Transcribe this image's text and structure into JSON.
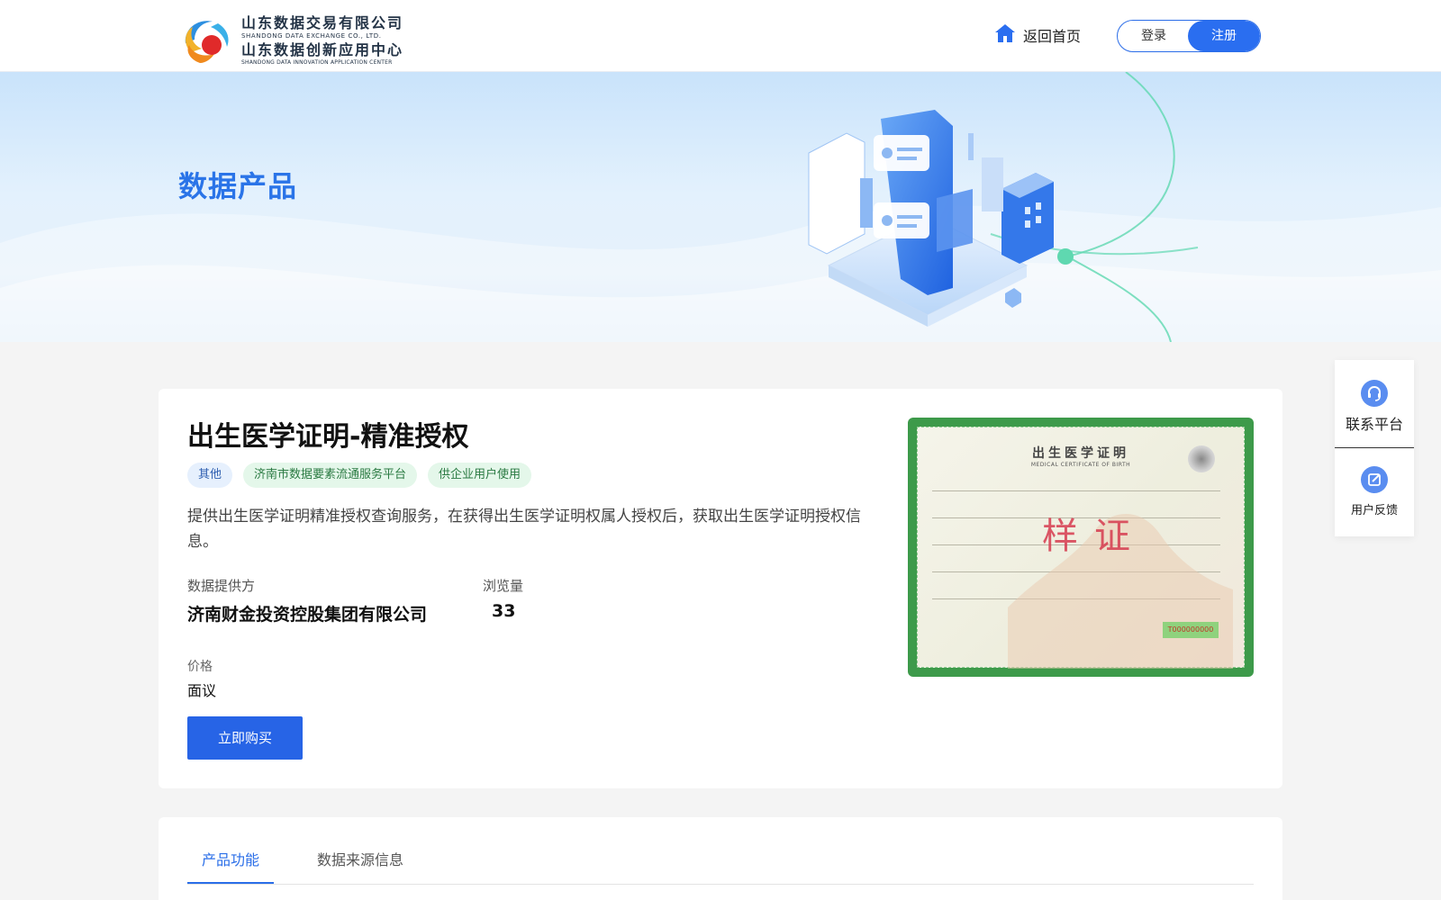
{
  "header": {
    "logo_cn_1": "山东数据交易有限公司",
    "logo_en_1": "SHANDONG DATA EXCHANGE CO., LTD.",
    "logo_cn_2": "山东数据创新应用中心",
    "logo_en_2": "SHANDONG DATA INNOVATION APPLICATION CENTER",
    "home_label": "返回首页",
    "login_label": "登录",
    "register_label": "注册"
  },
  "banner": {
    "title": "数据产品"
  },
  "product": {
    "title": "出生医学证明-精准授权",
    "tags": [
      {
        "label": "其他",
        "color": "#e6f0fd"
      },
      {
        "label": "济南市数据要素流通服务平台",
        "color": "#e4f7ea"
      },
      {
        "label": "供企业用户使用",
        "color": "#e4f7ea"
      }
    ],
    "description": "提供出生医学证明精准授权查询服务，在获得出生医学证明权属人授权后，获取出生医学证明授权信息。",
    "provider_label": "数据提供方",
    "provider_value": "济南财金投资控股集团有限公司",
    "views_label": "浏览量",
    "views_value": "33",
    "price_label": "价格",
    "price_value": "面议",
    "buy_label": "立即购买"
  },
  "certificate": {
    "title": "出生医学证明",
    "subtitle": "MEDICAL CERTIFICATE OF BIRTH",
    "stamp": "样证",
    "serial": "T000000000"
  },
  "float_panel": {
    "contact_label": "联系平台",
    "feedback_label": "用户反馈"
  },
  "tabs": {
    "items": [
      "产品功能",
      "数据来源信息"
    ],
    "active_index": 0
  },
  "colors": {
    "primary": "#2a6ef0",
    "button": "#2764e6",
    "banner_title": "#2a74e8",
    "tag_blue": "#e6f0fd",
    "tag_green": "#e4f7ea"
  }
}
